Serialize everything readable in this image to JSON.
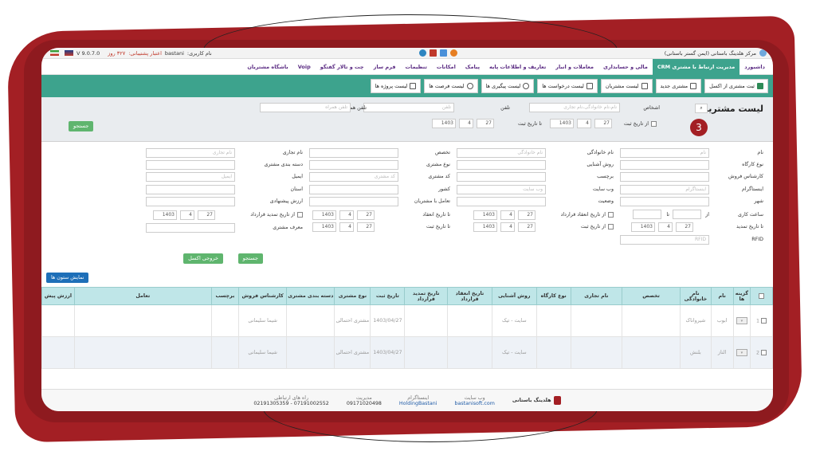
{
  "topbar": {
    "company": "مرکز هلدینگ باستانی (ایمن گستر باستانی)",
    "username_label": "نام کاربری:",
    "username": "bastani",
    "support_label": "اعتبار پشتیبانی:",
    "support_value": "۳۲۷ روز",
    "version": "V 9.0.7.0",
    "flag_ir": "flag-iran-icon",
    "flag_uk": "flag-uk-icon"
  },
  "menu": [
    {
      "label": "داشبورد",
      "active": false
    },
    {
      "label": "مدیریت ارتباط با مشتری CRM",
      "active": true
    },
    {
      "label": "مالی و حسابداری",
      "active": false
    },
    {
      "label": "معاملات و انبار",
      "active": false
    },
    {
      "label": "تعاریف و اطلاعات پایه",
      "active": false
    },
    {
      "label": "پیامک",
      "active": false
    },
    {
      "label": "امکانات",
      "active": false
    },
    {
      "label": "تنظیمات",
      "active": false
    },
    {
      "label": "فرم ساز",
      "active": false
    },
    {
      "label": "چت و تالار گفتگو",
      "active": false
    },
    {
      "label": "Voip",
      "active": false
    },
    {
      "label": "باشگاه مشتریان",
      "active": false
    }
  ],
  "toolbar": [
    {
      "label": "ثبت مشتری از اکسل",
      "icon": "excel-icon"
    },
    {
      "label": "مشتری جدید",
      "icon": "add-user-icon"
    },
    {
      "label": "لیست مشتریان",
      "icon": "list-icon"
    },
    {
      "label": "لیست درخواست ها",
      "icon": "request-icon"
    },
    {
      "label": "لیست پیگیری ها",
      "icon": "clock-icon"
    },
    {
      "label": "لیست فرصت ها",
      "icon": "lightbulb-icon"
    },
    {
      "label": "لیست پروژه ها",
      "icon": "project-icon"
    }
  ],
  "search": {
    "title": "لیست مشتریان",
    "persons_label": "اشخاص",
    "persons_placeholder": "نام،نام خانوادگی،نام تجاری",
    "phone_label": "تلفن",
    "phone_placeholder": "تلفن",
    "mobile_label": "تلفن همراه",
    "mobile_placeholder": "تلفن همراه",
    "from_date_label": "از تاریخ ثبت",
    "to_date_label": "تا تاریخ ثبت",
    "date_year": "1403",
    "date_month": "4",
    "date_day": "27",
    "search_button": "جستجو",
    "step_badge": "3"
  },
  "advanced": {
    "name_label": "نام",
    "name_placeholder": "نام",
    "family_label": "نام خانوادگی",
    "family_placeholder": "نام خانوادگی",
    "specialty_label": "تخصص",
    "brand_label": "نام تجاری",
    "brand_placeholder": "نام تجاری",
    "workshop_type_label": "نوع کارگاه",
    "acquaint_label": "روش آشنایی",
    "customer_type_label": "نوع مشتری",
    "category_label": "دسته بندی مشتری",
    "sales_expert_label": "کارشناس فروش",
    "tag_label": "برچسب",
    "customer_code_label": "کد مشتری",
    "customer_code_placeholder": "کد مشتری",
    "email_label": "ایمیل",
    "email_placeholder": "ایمیل",
    "instagram_label": "اینستاگرام",
    "instagram_placeholder": "اینستاگرام",
    "website_label": "وب سایت",
    "website_placeholder": "وب سایت",
    "country_label": "کشور",
    "province_label": "استان",
    "city_label": "شهر",
    "status_label": "وضعیت",
    "interaction_label": "تعامل با مشتریان",
    "proposed_value_label": "ارزش پیشنهادی",
    "work_hours_label": "ساعت کاری",
    "from": "از",
    "to": "تا",
    "contract_from_label": "از تاریخ انعقاد قرارداد",
    "contract_to_label": "تا تاریخ انعقاد",
    "contract_to_label2": "قرارداد",
    "renew_from_label": "از تاریخ تمدید قرارداد",
    "renew_to_label": "تا تاریخ تمدید",
    "reg_from_label": "از تاریخ ثبت",
    "reg_to_label": "تا تاریخ ثبت",
    "introducer_label": "معرف مشتری",
    "rfid_label": "RFID",
    "rfid_placeholder": "RFID",
    "search_button": "جستجو",
    "excel_button": "خروجی اکسل",
    "show_columns_button": "نمایش ستون ها"
  },
  "table": {
    "headers": [
      "گزینه ها",
      "نام",
      "نام خانوادگی",
      "تخصص",
      "نام تجاری",
      "نوع کارگاه",
      "روش آشنایی",
      "تاریخ انعقاد قرارداد",
      "تاریخ تمدید قرارداد",
      "تاریخ ثبت",
      "نوع مشتری",
      "دسته بندی مشتری",
      "کارشناس فروش",
      "برچسب",
      "تعامل",
      "ارزش پیش"
    ],
    "rows": [
      {
        "num": "1",
        "name": "ابوب",
        "family": "شیرواناک",
        "acquaint": "سایت - تیک",
        "reg_date": "1403/04/27",
        "customer_type": "مشتری احتمالی",
        "sales_expert": "شیما سلیمانی"
      },
      {
        "num": "2",
        "name": "الناز",
        "family": "بلنش",
        "acquaint": "سایت - تیک",
        "reg_date": "1403/04/27",
        "customer_type": "مشتری احتمالی",
        "sales_expert": "شیما سلیمانی"
      }
    ]
  },
  "footer": {
    "brand": "هلدینگ باستانی",
    "website_label": "وب سایت",
    "website": "bastanisoft.com",
    "instagram_label": "اینستاگرام",
    "instagram": "HoldingBastani",
    "management_label": "مدیریت",
    "management_phone": "09171020498",
    "contact_label": "راه های ارتباطی",
    "contact_phones": "07191002552 - 02191305359"
  }
}
